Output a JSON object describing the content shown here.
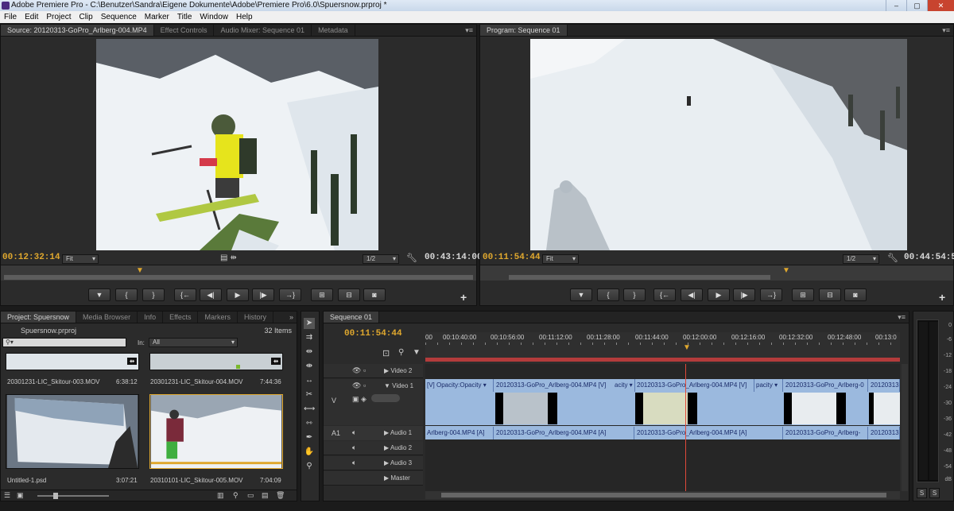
{
  "window": {
    "title": "Adobe Premiere Pro - C:\\Benutzer\\Sandra\\Eigene Dokumente\\Adobe\\Premiere Pro\\6.0\\Spuersnow.prproj *"
  },
  "menu": [
    "File",
    "Edit",
    "Project",
    "Clip",
    "Sequence",
    "Marker",
    "Title",
    "Window",
    "Help"
  ],
  "source_panel": {
    "tabs": [
      "Source: 20120313-GoPro_Arlberg-004.MP4",
      "Effect Controls",
      "Audio Mixer: Sequence 01",
      "Metadata"
    ],
    "timecode_in": "00:12:32:14",
    "timecode_duration": "00:43:14:00",
    "fit": "Fit",
    "resolution": "1/2"
  },
  "program_panel": {
    "tabs": [
      "Program: Sequence 01"
    ],
    "timecode_in": "00:11:54:44",
    "timecode_duration": "00:44:54:56",
    "fit": "Fit",
    "resolution": "1/2"
  },
  "transport": {
    "buttons": [
      "marker",
      "mark-in",
      "mark-out",
      "goto-in",
      "step-back",
      "play",
      "step-forward",
      "goto-out",
      "insert",
      "overwrite",
      "export-frame"
    ]
  },
  "project_panel": {
    "tabs": [
      "Project: Spuersnow",
      "Media Browser",
      "Info",
      "Effects",
      "Markers",
      "History"
    ],
    "file": "Spuersnow.prproj",
    "count": "32 Items",
    "search_placeholder": "",
    "in_label": "In:",
    "in_value": "All",
    "items": [
      {
        "name": "20301231-LIC_Skitour-003.MOV",
        "duration": "6:38:12"
      },
      {
        "name": "20301231-LIC_Skitour-004.MOV",
        "duration": "7:44:36"
      },
      {
        "name": "Untitled-1.psd",
        "duration": "3:07:21"
      },
      {
        "name": "20310101-LIC_Skitour-005.MOV",
        "duration": "7:04:09"
      }
    ]
  },
  "timeline": {
    "tab": "Sequence 01",
    "timecode": "00:11:54:44",
    "ruler": [
      "00",
      "00:10:40:00",
      "00:10:56:00",
      "00:11:12:00",
      "00:11:28:00",
      "00:11:44:00",
      "00:12:00:00",
      "00:12:16:00",
      "00:12:32:00",
      "00:12:48:00",
      "00:13:0"
    ],
    "tracks": {
      "video2": "Video 2",
      "video1": "Video 1",
      "audio1": "Audio 1",
      "audio2": "Audio 2",
      "audio3": "Audio 3",
      "master": "Master",
      "v_label": "V",
      "a1_label": "A1"
    },
    "video_clips": [
      "[V] Opacity:Opacity ▾",
      "20120313-GoPro_Arlberg-004.MP4 [V]",
      "acity ▾",
      "20120313-GoPro_Arlberg-004.MP4 [V]",
      "pacity ▾",
      "20120313-GoPro_Arlberg-0",
      "20120313-"
    ],
    "audio_clips": [
      "Arlberg-004.MP4 [A]",
      "20120313-GoPro_Arlberg-004.MP4 [A]",
      "20120313-GoPro_Arlberg-004.MP4 [A]",
      "20120313-GoPro_Arlberg-",
      "20120313-"
    ]
  },
  "meters": {
    "labels": [
      "0",
      "-6",
      "-12",
      "-18",
      "-24",
      "-30",
      "-36",
      "-42",
      "-48",
      "-54",
      "dB"
    ],
    "solo": [
      "S",
      "S"
    ]
  }
}
